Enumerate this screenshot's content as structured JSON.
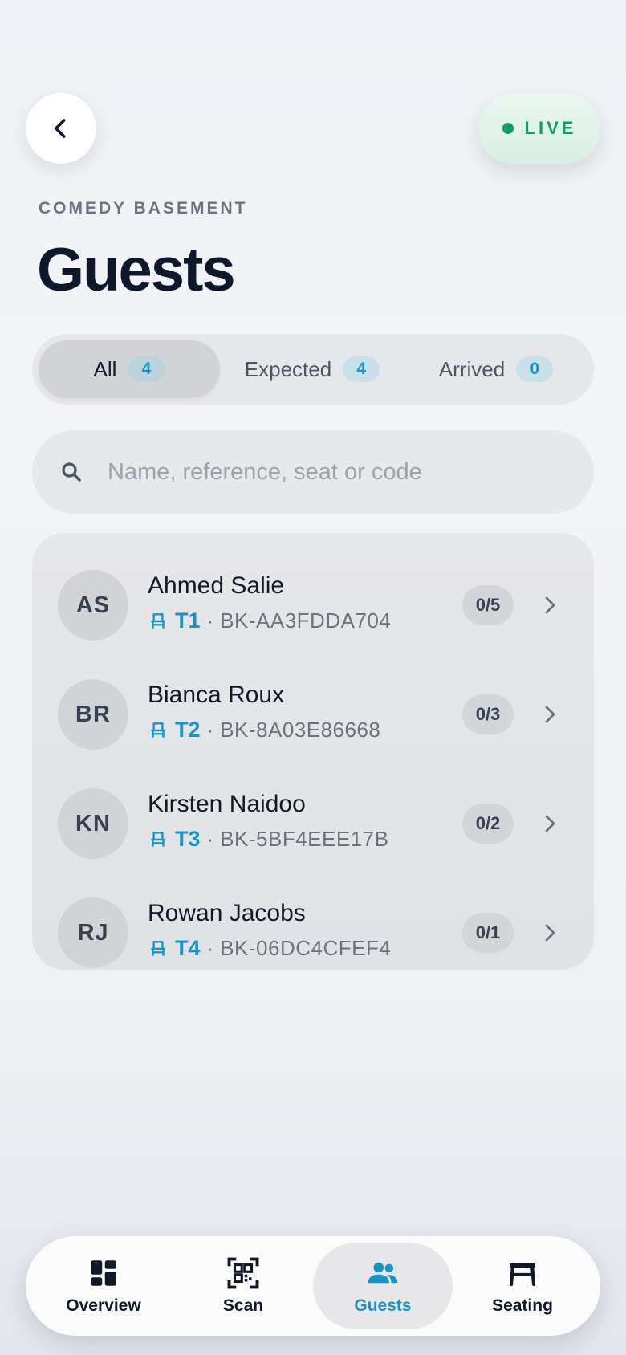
{
  "header": {
    "back_icon": "chevron-left-icon",
    "live_label": "LIVE",
    "live_color": "#0f9d6b"
  },
  "venue": "COMEDY BASEMENT",
  "title": "Guests",
  "filters": [
    {
      "label": "All",
      "count": "4",
      "active": true
    },
    {
      "label": "Expected",
      "count": "4",
      "active": false
    },
    {
      "label": "Arrived",
      "count": "0",
      "active": false
    }
  ],
  "search": {
    "icon": "search-icon",
    "placeholder": "Name, reference, seat or code",
    "value": ""
  },
  "guests": [
    {
      "initials": "AS",
      "name": "Ahmed Salie",
      "table": "T1",
      "ref": "BK-AA3FDDA704",
      "checked_in": "0/5"
    },
    {
      "initials": "BR",
      "name": "Bianca Roux",
      "table": "T2",
      "ref": "BK-8A03E86668",
      "checked_in": "0/3"
    },
    {
      "initials": "KN",
      "name": "Kirsten Naidoo",
      "table": "T3",
      "ref": "BK-5BF4EEE17B",
      "checked_in": "0/2"
    },
    {
      "initials": "RJ",
      "name": "Rowan Jacobs",
      "table": "T4",
      "ref": "BK-06DC4CFEF4",
      "checked_in": "0/1"
    }
  ],
  "separator": "·",
  "nav": [
    {
      "label": "Overview",
      "icon": "dashboard-icon",
      "active": false
    },
    {
      "label": "Scan",
      "icon": "qr-code-icon",
      "active": false
    },
    {
      "label": "Guests",
      "icon": "people-icon",
      "active": true
    },
    {
      "label": "Seating",
      "icon": "table-icon",
      "active": false
    }
  ],
  "colors": {
    "accent": "#1696c8",
    "dark": "#0f172a"
  }
}
